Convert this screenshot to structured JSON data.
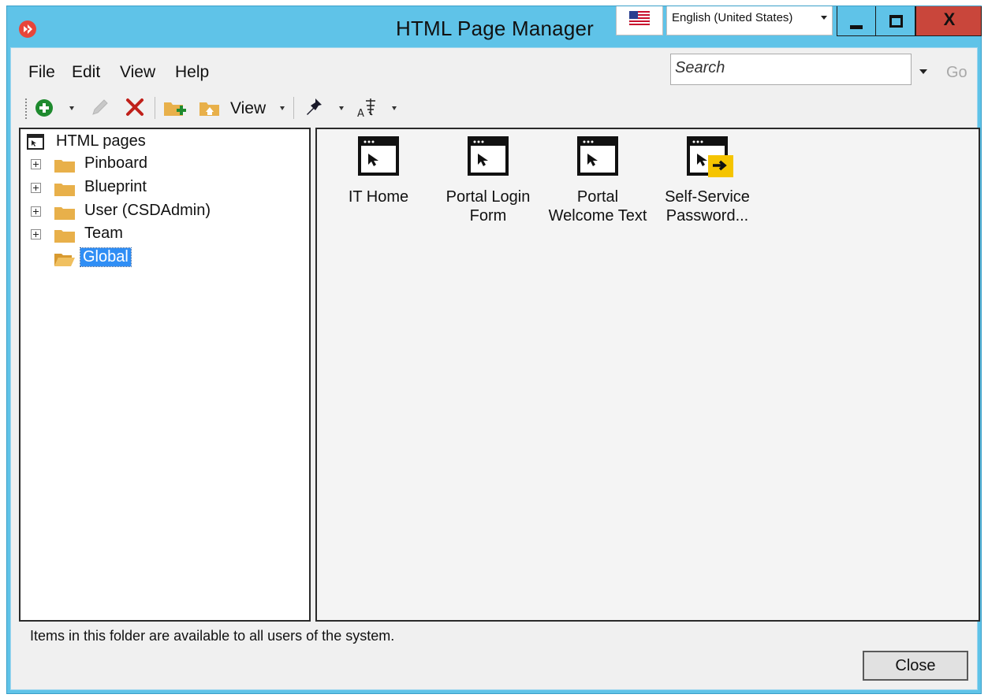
{
  "window": {
    "title": "HTML Page Manager",
    "language": "English (United States)",
    "close_glyph": "X"
  },
  "menu": {
    "file": "File",
    "edit": "Edit",
    "view": "View",
    "help": "Help"
  },
  "search": {
    "placeholder": "Search",
    "go_label": "Go"
  },
  "toolbar": {
    "view_label": "View",
    "icons": [
      "add-icon",
      "edit-pencil-icon",
      "delete-x-icon",
      "new-folder-icon",
      "home-folder-icon",
      "pin-icon",
      "font-size-icon"
    ]
  },
  "tree": {
    "root_label": "HTML pages",
    "items": [
      {
        "label": "Pinboard",
        "expandable": true
      },
      {
        "label": "Blueprint",
        "expandable": true
      },
      {
        "label": "User (CSDAdmin)",
        "expandable": true
      },
      {
        "label": "Team",
        "expandable": true
      },
      {
        "label": "Global",
        "expandable": false,
        "selected": true
      }
    ]
  },
  "pages": [
    {
      "line1": "IT Home",
      "line2": ""
    },
    {
      "line1": "Portal Login",
      "line2": "Form"
    },
    {
      "line1": "Portal",
      "line2": "Welcome Text"
    },
    {
      "line1": "Self-Service",
      "line2": "Password...",
      "badge": "arrow-badge-icon"
    }
  ],
  "status": {
    "text": "Items in this folder are available to all users of the system."
  },
  "buttons": {
    "close": "Close"
  },
  "colors": {
    "titlebar": "#5fc3e8",
    "close_button": "#c9463b",
    "selection": "#2f8ef5",
    "folder": "#e8b04a",
    "add_green": "#1e8a2e",
    "delete_red": "#c0201a",
    "badge_yellow": "#f5c400"
  }
}
